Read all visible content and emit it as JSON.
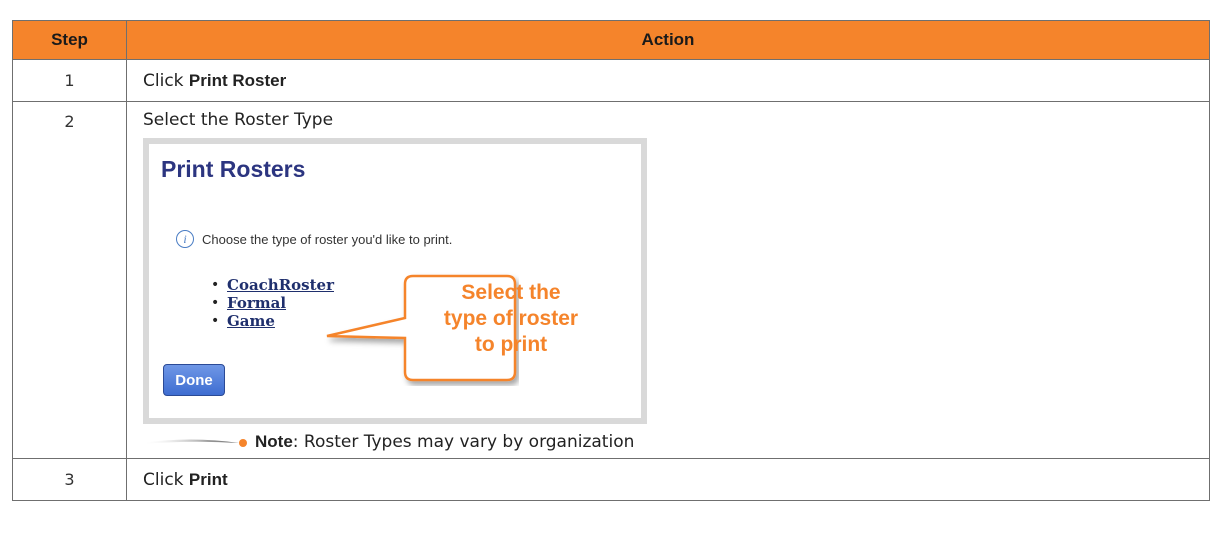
{
  "table": {
    "headers": {
      "step": "Step",
      "action": "Action"
    },
    "rows": [
      {
        "step": "1",
        "prefix": "Click ",
        "bold": "Print Roster"
      },
      {
        "step": "2",
        "text": "Select the Roster Type"
      },
      {
        "step": "3",
        "prefix": "Click ",
        "bold": "Print"
      }
    ]
  },
  "screenshot": {
    "title": "Print Rosters",
    "info": "Choose the type of roster you'd like to print.",
    "links": [
      "CoachRoster",
      "Formal",
      "Game"
    ],
    "done_label": "Done",
    "callout": [
      "Select the",
      "type of roster",
      "to print"
    ]
  },
  "note": {
    "label": "Note",
    "text": ": Roster Types may vary by organization"
  },
  "colors": {
    "header_bg": "#f5842b",
    "callout": "#f5842b",
    "title": "#2c3580"
  }
}
